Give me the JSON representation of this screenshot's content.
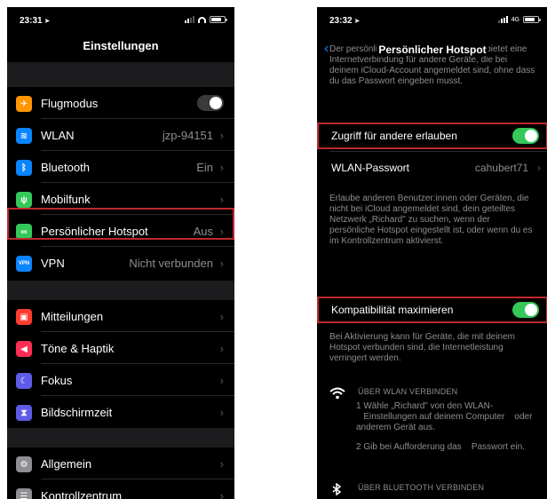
{
  "left": {
    "time": "23:31",
    "title": "Einstellungen",
    "items": [
      {
        "label": "Flugmodus",
        "value": "",
        "icon": "airplane-icon",
        "color": "#ff9500",
        "glyph": "✈"
      },
      {
        "label": "WLAN",
        "value": "jzp-94151",
        "icon": "wifi-icon",
        "color": "#0a84ff",
        "glyph": "≋"
      },
      {
        "label": "Bluetooth",
        "value": "Ein",
        "icon": "bluetooth-icon",
        "color": "#0a84ff",
        "glyph": "ᛒ"
      },
      {
        "label": "Mobilfunk",
        "value": "",
        "icon": "antenna-icon",
        "color": "#34c759",
        "glyph": "ψ"
      },
      {
        "label": "Persönlicher Hotspot",
        "value": "Aus",
        "icon": "hotspot-icon",
        "color": "#34c759",
        "glyph": "∞"
      },
      {
        "label": "VPN",
        "value": "Nicht verbunden",
        "icon": "vpn-icon",
        "color": "#0a84ff",
        "glyph": "VPN"
      },
      {
        "label": "Mitteilungen",
        "value": "",
        "icon": "notifications-icon",
        "color": "#ff3b30",
        "glyph": "▣"
      },
      {
        "label": "Töne & Haptik",
        "value": "",
        "icon": "speaker-icon",
        "color": "#ff2d55",
        "glyph": "◀"
      },
      {
        "label": "Fokus",
        "value": "",
        "icon": "moon-icon",
        "color": "#5e5ce6",
        "glyph": "☾"
      },
      {
        "label": "Bildschirmzeit",
        "value": "",
        "icon": "hourglass-icon",
        "color": "#5e5ce6",
        "glyph": "⧗"
      },
      {
        "label": "Allgemein",
        "value": "",
        "icon": "gear-icon",
        "color": "#8e8e93",
        "glyph": "⚙"
      },
      {
        "label": "Kontrollzentrum",
        "value": "",
        "icon": "toggles-icon",
        "color": "#8e8e93",
        "glyph": "☰"
      }
    ]
  },
  "right": {
    "time": "23:32",
    "network": "4G",
    "title": "Persönlicher Hotspot",
    "intro": "Der persönliche Hotspot deines iPhone bietet eine Internetverbindung für andere Geräte, die bei deinem iCloud-Account angemeldet sind, ohne dass du das Passwort eingeben musst.",
    "allow_label": "Zugriff für andere erlauben",
    "password_label": "WLAN-Passwort",
    "password_value": "cahubert71",
    "allow_note": "Erlaube anderen Benutzer:innen oder Geräten, die nicht bei iCloud angemeldet sind, dein geteiltes Netzwerk „Richard\" zu suchen, wenn der persönliche Hotspot eingestellt ist, oder wenn du es im Kontrollzentrum aktivierst.",
    "compat_label": "Kompatibilität maximieren",
    "compat_note": "Bei Aktivierung kann für Geräte, die mit deinem Hotspot verbunden sind, die Internetleistung verringert werden.",
    "wlan_heading": "ÜBER WLAN VERBINDEN",
    "wlan_step1": "1 Wähle „Richard\" von den WLAN-   Einstellungen auf deinem Computer    oder anderem Gerät aus.",
    "wlan_step2": "2 Gib bei Aufforderung das    Passwort ein.",
    "bt_heading": "ÜBER BLUETOOTH VERBINDEN"
  },
  "colors": {
    "highlight": "#c0272d",
    "toggle_on": "#34c759",
    "accent": "#0a84ff"
  }
}
